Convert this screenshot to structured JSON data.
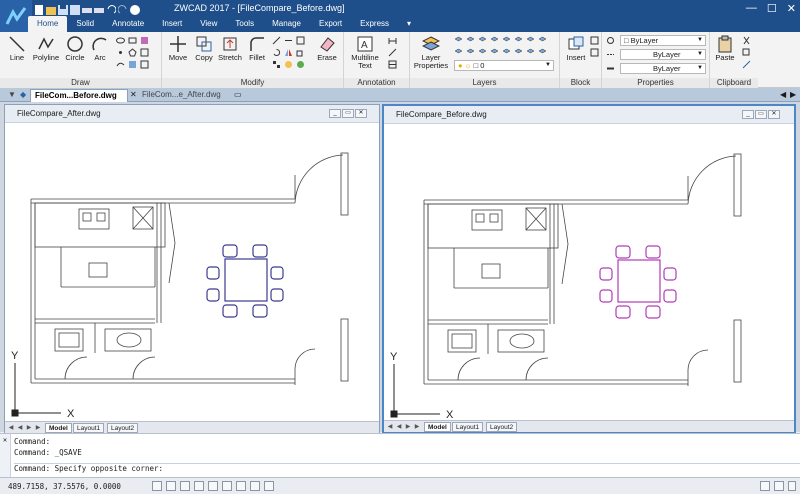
{
  "window": {
    "title": "ZWCAD 2017 - [FileCompare_Before.dwg]",
    "min_glyph": "—",
    "max_glyph": "☐",
    "close_glyph": "✕"
  },
  "ribbon_tabs": [
    "Home",
    "Solid",
    "Annotate",
    "Insert",
    "View",
    "Tools",
    "Manage",
    "Export",
    "Express"
  ],
  "ribbon": {
    "draw": {
      "label": "Draw",
      "tools": [
        "Line",
        "Polyline",
        "Circle",
        "Arc"
      ]
    },
    "modify": {
      "label": "Modify",
      "tools": [
        "Move",
        "Copy",
        "Stretch",
        "Fillet",
        "Erase"
      ]
    },
    "annotation": {
      "label": "Annotation",
      "multiline_text": "Multiline Text"
    },
    "layers": {
      "label": "Layers",
      "layer_properties": "Layer Properties",
      "current_layer": "0"
    },
    "block": {
      "label": "Block",
      "insert": "Insert"
    },
    "properties": {
      "label": "Properties",
      "color": "ByLayer",
      "linetype": "ByLayer",
      "lineweight": "ByLayer"
    },
    "clipboard": {
      "label": "Clipboard",
      "paste": "Paste"
    }
  },
  "doc_tabs": [
    {
      "label": "FileCom...Before.dwg",
      "active": true
    },
    {
      "label": "FileCom...e_After.dwg",
      "active": false
    }
  ],
  "drawings": [
    {
      "title": "FileCompare_After.dwg",
      "furniture_color": "#3b3b8f",
      "layout_tabs": [
        "Model",
        "Layout1",
        "Layout2"
      ]
    },
    {
      "title": "FileCompare_Before.dwg",
      "furniture_color": "#b03cb8",
      "layout_tabs": [
        "Model",
        "Layout1",
        "Layout2"
      ]
    }
  ],
  "axis": {
    "x": "X",
    "y": "Y"
  },
  "command_lines": [
    "Command:",
    "Command: _QSAVE",
    "Command: Specify opposite corner:"
  ],
  "status": {
    "coords": "489.7158, 37.5576, 0.0000"
  },
  "colors": {
    "title_bar": "#1e4f8a",
    "active_window_border": "#4a86c8"
  }
}
